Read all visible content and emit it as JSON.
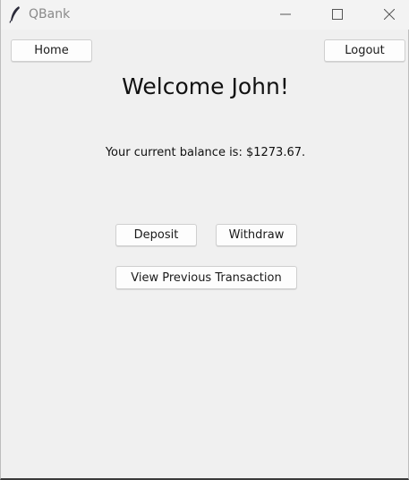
{
  "window": {
    "title": "QBank",
    "icon": "feather-icon"
  },
  "nav": {
    "home_label": "Home",
    "logout_label": "Logout"
  },
  "main": {
    "welcome_text": "Welcome John!",
    "balance_text": "Your current balance is: $1273.67."
  },
  "actions": {
    "deposit_label": "Deposit",
    "withdraw_label": "Withdraw",
    "history_label": "View Previous Transaction"
  }
}
